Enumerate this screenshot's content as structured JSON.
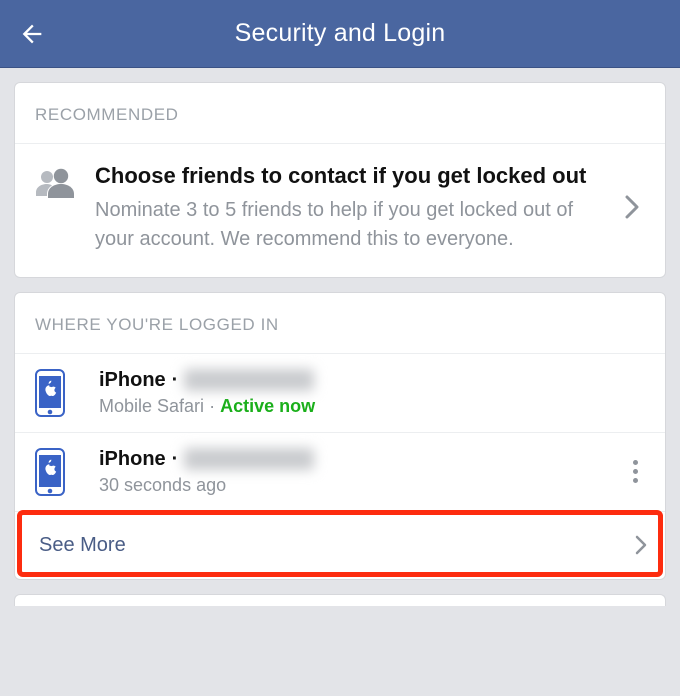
{
  "header": {
    "title": "Security and Login"
  },
  "recommended": {
    "label": "RECOMMENDED",
    "title": "Choose friends to contact if you get locked out",
    "subtitle": "Nominate 3 to 5 friends to help if you get locked out of your account. We recommend this to everyone."
  },
  "logged_in": {
    "label": "WHERE YOU'RE LOGGED IN",
    "sessions": [
      {
        "device": "iPhone",
        "sep": "·",
        "browser": "Mobile Safari",
        "sep2": "·",
        "status": "Active now"
      },
      {
        "device": "iPhone",
        "sep": "·",
        "time": "30 seconds ago"
      }
    ],
    "see_more": "See More"
  }
}
